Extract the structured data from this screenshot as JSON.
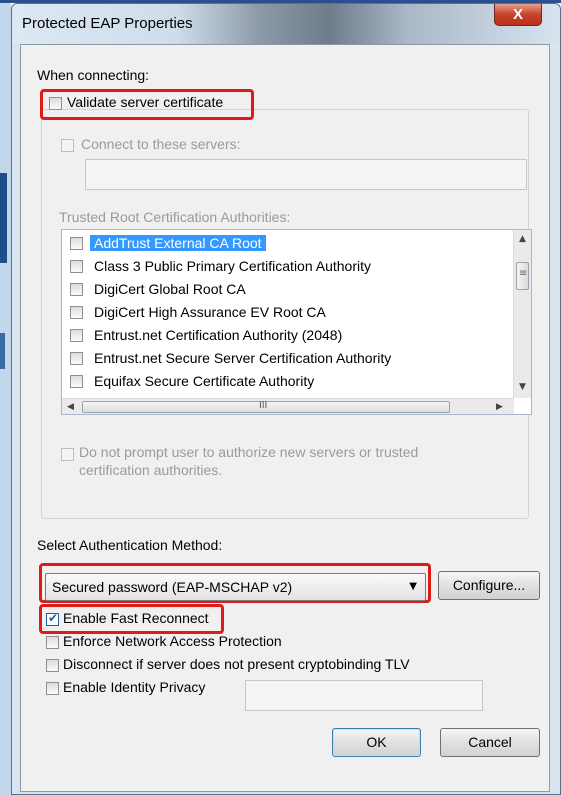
{
  "dialog": {
    "title": "Protected EAP Properties",
    "close_glyph": "X"
  },
  "when_connecting": {
    "label": "When connecting:",
    "validate_server_certificate": {
      "label": "Validate server certificate",
      "checked": false
    },
    "connect_to_servers": {
      "label": "Connect to these servers:",
      "checked": false,
      "value": ""
    },
    "trusted_root_label": "Trusted Root Certification Authorities:",
    "authorities": [
      {
        "name": "AddTrust External CA Root",
        "checked": false,
        "selected": true
      },
      {
        "name": "Class 3 Public Primary Certification Authority",
        "checked": false
      },
      {
        "name": "DigiCert Global Root CA",
        "checked": false
      },
      {
        "name": "DigiCert High Assurance EV Root CA",
        "checked": false
      },
      {
        "name": "Entrust.net Certification Authority (2048)",
        "checked": false
      },
      {
        "name": "Entrust.net Secure Server Certification Authority",
        "checked": false
      },
      {
        "name": "Equifax Secure Certificate Authority",
        "checked": false
      }
    ],
    "do_not_prompt": {
      "line1": "Do not prompt user to authorize new servers or trusted",
      "line2": "certification authorities.",
      "checked": false
    }
  },
  "authentication": {
    "label": "Select Authentication Method:",
    "selected_method": "Secured password (EAP-MSCHAP v2)",
    "configure_label": "Configure..."
  },
  "options": {
    "enable_fast_reconnect": {
      "label": "Enable Fast Reconnect",
      "checked": true
    },
    "enforce_nap": {
      "label": "Enforce Network Access Protection",
      "checked": false
    },
    "disconnect_cryptobinding": {
      "label": "Disconnect if server does not present cryptobinding TLV",
      "checked": false
    },
    "enable_identity_privacy": {
      "label": "Enable Identity Privacy",
      "checked": false,
      "value": ""
    }
  },
  "buttons": {
    "ok": "OK",
    "cancel": "Cancel"
  },
  "scrollbars": {
    "hscroll_grip": "III",
    "vscroll_grip": "≡"
  },
  "colors": {
    "highlight_red": "#e01919",
    "selection_blue": "#3399ff"
  }
}
